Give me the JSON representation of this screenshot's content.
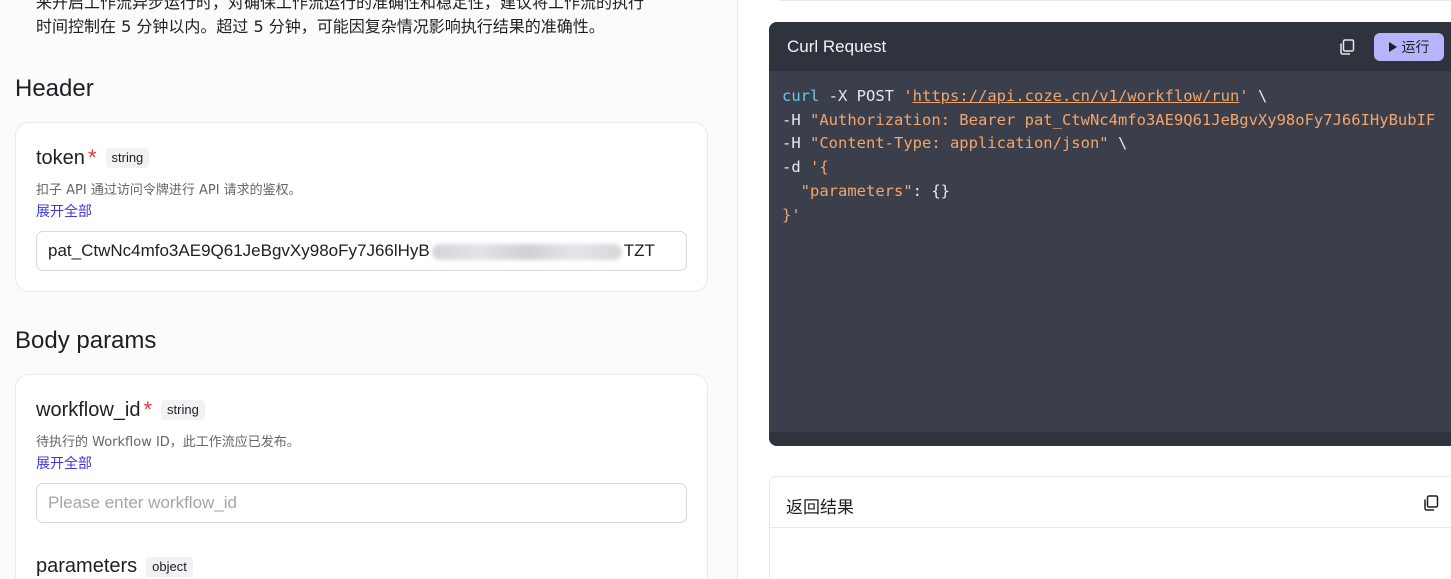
{
  "intro": {
    "line1": "来开启工作流异步运行时，对确保工作流运行的准确性和稳定性，建议将工作流的执行",
    "line2": "时间控制在 5 分钟以内。超过 5 分钟，可能因复杂情况影响执行结果的准确性。"
  },
  "header_section": {
    "title": "Header",
    "token": {
      "name": "token",
      "required_mark": "*",
      "type": "string",
      "description": "扣子 API 通过访问令牌进行 API 请求的鉴权。",
      "expand_label": "展开全部",
      "value_prefix": "pat_CtwNc4mfo3AE9Q61JeBgvXy98oFy7J66lHyB",
      "value_suffix": "TZT"
    }
  },
  "body_section": {
    "title": "Body params",
    "workflow_id": {
      "name": "workflow_id",
      "required_mark": "*",
      "type": "string",
      "description": "待执行的 Workflow ID，此工作流应已发布。",
      "expand_label": "展开全部",
      "placeholder": "Please enter workflow_id"
    },
    "parameters": {
      "name": "parameters",
      "type": "object"
    }
  },
  "curl_panel": {
    "title": "Curl Request",
    "run_label": "运行",
    "copy_icon": "copy-icon",
    "lines": {
      "l1_cmd": "curl",
      "l1_flag": " -X POST ",
      "l1_q1": "'",
      "l1_url": "https://api.coze.cn/v1/workflow/run",
      "l1_q2": "'",
      "l1_tail": " \\",
      "l2_flag": "-H ",
      "l2_str": "\"Authorization: Bearer pat_CtwNc4mfo3AE9Q61JeBgvXy98oFy7J66IHyBubIF",
      "l3_flag": "-H ",
      "l3_str": "\"Content-Type: application/json\"",
      "l3_tail": " \\",
      "l4_flag": "-d ",
      "l4_str": "'{",
      "l5_key": "  \"parameters\"",
      "l5_rest": ": {}",
      "l6_str": "}'"
    }
  },
  "result_panel": {
    "title": "返回结果",
    "copy_icon": "copy-icon"
  }
}
